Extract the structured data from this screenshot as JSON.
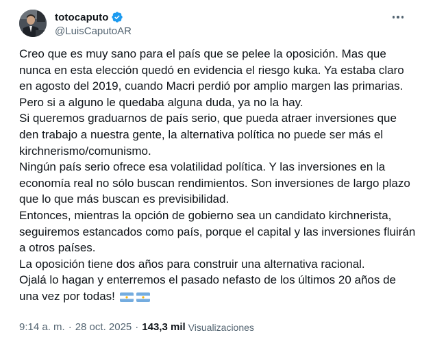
{
  "author": {
    "display_name": "totocaputo",
    "handle": "@LuisCaputoAR"
  },
  "tweet": {
    "paragraphs": [
      "Creo que es muy sano para el país que se pelee la oposición. Mas que nunca en esta elección quedó en evidencia el riesgo kuka. Ya estaba claro en agosto del 2019, cuando Macri perdió por amplio margen las primarias. Pero si a alguno le quedaba alguna duda, ya no la hay.",
      "Si queremos graduarnos de país serio, que pueda atraer inversiones que den trabajo a nuestra gente, la alternativa política no puede ser más el kirchnerismo/comunismo.",
      "Ningún país serio ofrece esa volatilidad política. Y las inversiones en la economía real no sólo buscan rendimientos. Son inversiones de largo plazo que lo que más buscan es previsibilidad.",
      "Entonces, mientras la opción de gobierno sea un candidato kirchnerista, seguiremos estancados como país, porque el capital y las inversiones fluirán a otros países.",
      "La oposición tiene dos años para construir una alternativa racional.",
      "Ojalá lo hagan y enterremos el pasado nefasto de los últimos 20 años de una vez por todas!"
    ],
    "emoji": [
      "argentina-flag",
      "argentina-flag"
    ]
  },
  "meta": {
    "time": "9:14 a. m.",
    "separator": "·",
    "date": "28 oct. 2025",
    "views_count": "143,3 mil",
    "views_label": "Visualizaciones"
  },
  "colors": {
    "text": "#0f1419",
    "secondary": "#536471",
    "verified": "#1d9bf0",
    "flag_blue": "#74acdf",
    "flag_sun": "#f6b40e"
  }
}
